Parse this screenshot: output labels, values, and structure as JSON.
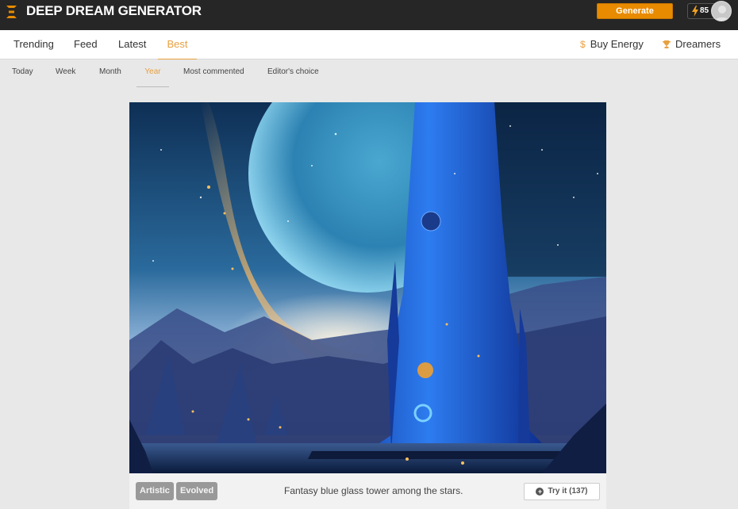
{
  "header": {
    "brand": "DEEP DREAM GENERATOR",
    "generate_label": "Generate",
    "energy_value": "85",
    "accent_color": "#e88b00"
  },
  "mainnav": {
    "tabs": [
      {
        "label": "Trending"
      },
      {
        "label": "Feed"
      },
      {
        "label": "Latest"
      },
      {
        "label": "Best",
        "active": true
      }
    ],
    "right": [
      {
        "label": "Buy Energy",
        "icon": "dollar-icon"
      },
      {
        "label": "Dreamers",
        "icon": "trophy-icon"
      }
    ]
  },
  "subnav": {
    "tabs": [
      {
        "label": "Today"
      },
      {
        "label": "Week"
      },
      {
        "label": "Month"
      },
      {
        "label": "Year",
        "active": true
      },
      {
        "label": "Most commented"
      },
      {
        "label": "Editor's choice"
      }
    ]
  },
  "card": {
    "image_alt": "Fantasy blue glass tower among the stars.",
    "tags": [
      "Artistic",
      "Evolved"
    ],
    "caption": "Fantasy blue glass tower among the stars.",
    "try_label": "Try it (137)"
  }
}
